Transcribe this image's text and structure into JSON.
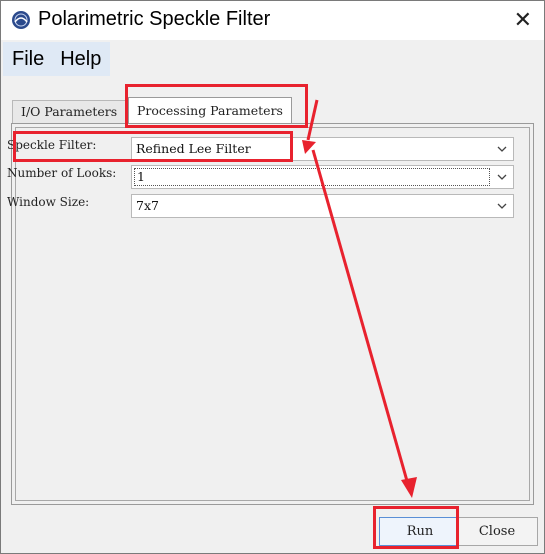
{
  "window": {
    "title": "Polarimetric Speckle Filter",
    "close_glyph": "✕"
  },
  "menu": {
    "items": [
      "File",
      "Help"
    ]
  },
  "tabs": [
    {
      "label": "I/O Parameters"
    },
    {
      "label": "Processing Parameters"
    }
  ],
  "form": {
    "speckle_filter": {
      "label": "Speckle Filter:",
      "value": "Refined Lee Filter"
    },
    "number_of_looks": {
      "label": "Number of Looks:",
      "value": "1"
    },
    "window_size": {
      "label": "Window Size:",
      "value": "7x7"
    }
  },
  "buttons": {
    "run": "Run",
    "close": "Close"
  },
  "colors": {
    "annotation": "#e8222e",
    "icon_blue": "#2b4a8c"
  }
}
